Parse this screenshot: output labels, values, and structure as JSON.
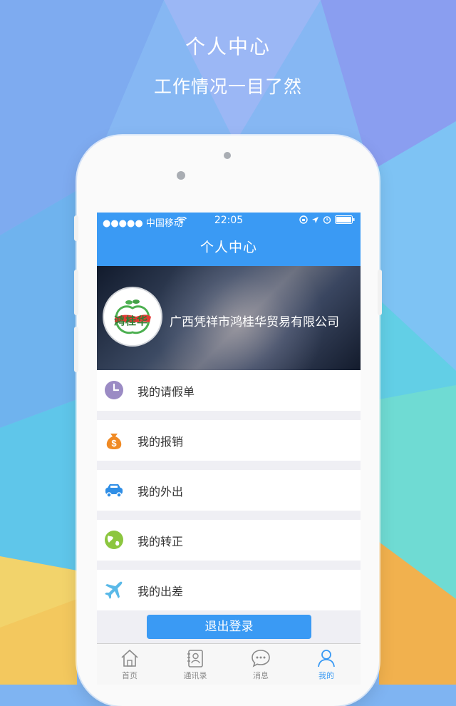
{
  "promo": {
    "title": "个人中心",
    "subtitle": "工作情况一目了然"
  },
  "status_bar": {
    "carrier": "●●●●● 中国移动",
    "time": "22:05"
  },
  "nav": {
    "title": "个人中心"
  },
  "profile": {
    "logo_text": "鸿桂华",
    "company_name": "广西凭祥市鸿桂华贸易有限公司"
  },
  "menu": [
    {
      "label": "我的请假单",
      "icon": "clock-icon",
      "color": "#9b8bc4"
    },
    {
      "label": "我的报销",
      "icon": "money-bag-icon",
      "color": "#f08a24"
    },
    {
      "label": "我的外出",
      "icon": "car-icon",
      "color": "#2f8ee6"
    },
    {
      "label": "我的转正",
      "icon": "globe-icon",
      "color": "#8cc63f"
    },
    {
      "label": "我的出差",
      "icon": "airplane-icon",
      "color": "#5ab9e8"
    }
  ],
  "logout_label": "退出登录",
  "tabs": [
    {
      "label": "首页",
      "icon": "home-icon",
      "active": false
    },
    {
      "label": "通讯录",
      "icon": "contacts-icon",
      "active": false
    },
    {
      "label": "消息",
      "icon": "chat-icon",
      "active": false
    },
    {
      "label": "我的",
      "icon": "user-icon",
      "active": true
    }
  ],
  "colors": {
    "accent": "#3a9af4",
    "background": "#efeff4"
  }
}
